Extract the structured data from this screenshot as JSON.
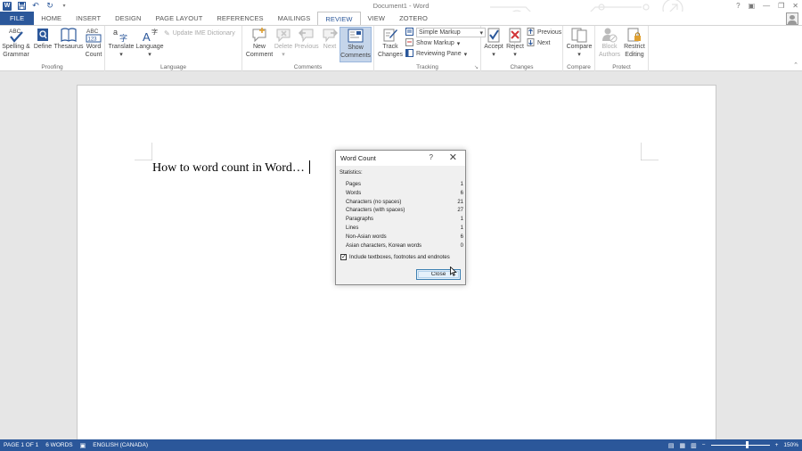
{
  "window": {
    "title": "Document1 - Word",
    "controls": [
      "?",
      "▣",
      "—",
      "❐",
      "✕"
    ]
  },
  "quick_access": {
    "icons": [
      "word-app-icon",
      "save-icon",
      "undo-icon",
      "redo-icon",
      "customize-icon"
    ]
  },
  "tabs": [
    {
      "label": "FILE",
      "active": false
    },
    {
      "label": "HOME",
      "active": false
    },
    {
      "label": "INSERT",
      "active": false
    },
    {
      "label": "DESIGN",
      "active": false
    },
    {
      "label": "PAGE LAYOUT",
      "active": false
    },
    {
      "label": "REFERENCES",
      "active": false
    },
    {
      "label": "MAILINGS",
      "active": false
    },
    {
      "label": "REVIEW",
      "active": true
    },
    {
      "label": "VIEW",
      "active": false
    },
    {
      "label": "ZOTERO",
      "active": false
    }
  ],
  "ribbon": {
    "proofing": {
      "label": "Proofing",
      "spelling_line1": "Spelling &",
      "spelling_line2": "Grammar",
      "define": "Define",
      "thesaurus": "Thesaurus",
      "word_count_line1": "Word",
      "word_count_line2": "Count",
      "abc_glyph": "ABC",
      "abc123_line1": "ABC",
      "abc123_line2": "123"
    },
    "language": {
      "label": "Language",
      "translate": "Translate",
      "language": "Language",
      "update_ime": "Update IME Dictionary"
    },
    "comments": {
      "label": "Comments",
      "new_line1": "New",
      "new_line2": "Comment",
      "delete": "Delete",
      "previous": "Previous",
      "next": "Next",
      "show_line1": "Show",
      "show_line2": "Comments"
    },
    "tracking": {
      "label": "Tracking",
      "track_line1": "Track",
      "track_line2": "Changes",
      "markup_select": "Simple Markup",
      "show_markup": "Show Markup",
      "reviewing_pane": "Reviewing Pane"
    },
    "changes": {
      "label": "Changes",
      "accept": "Accept",
      "reject": "Reject",
      "previous": "Previous",
      "next": "Next"
    },
    "compare": {
      "label": "Compare",
      "compare": "Compare"
    },
    "protect": {
      "label": "Protect",
      "block_line1": "Block",
      "block_line2": "Authors",
      "restrict_line1": "Restrict",
      "restrict_line2": "Editing"
    }
  },
  "document": {
    "text": "How to word count in Word…"
  },
  "dialog": {
    "title": "Word Count",
    "help": "?",
    "section": "Statistics:",
    "rows": [
      {
        "label": "Pages",
        "value": "1"
      },
      {
        "label": "Words",
        "value": "6"
      },
      {
        "label": "Characters (no spaces)",
        "value": "21"
      },
      {
        "label": "Characters (with spaces)",
        "value": "27"
      },
      {
        "label": "Paragraphs",
        "value": "1"
      },
      {
        "label": "Lines",
        "value": "1"
      },
      {
        "label": "Non-Asian words",
        "value": "6"
      },
      {
        "label": "Asian characters, Korean words",
        "value": "0"
      }
    ],
    "checkbox_label": "Include textboxes, footnotes and endnotes",
    "checkbox_checked": true,
    "close_label": "Close"
  },
  "statusbar": {
    "page": "PAGE 1 OF 1",
    "words": "6 WORDS",
    "language": "ENGLISH (CANADA)",
    "zoom": "150%",
    "zoom_level": 0.6
  },
  "colors": {
    "accent": "#2b579a",
    "selection": "#c5d5ea"
  }
}
